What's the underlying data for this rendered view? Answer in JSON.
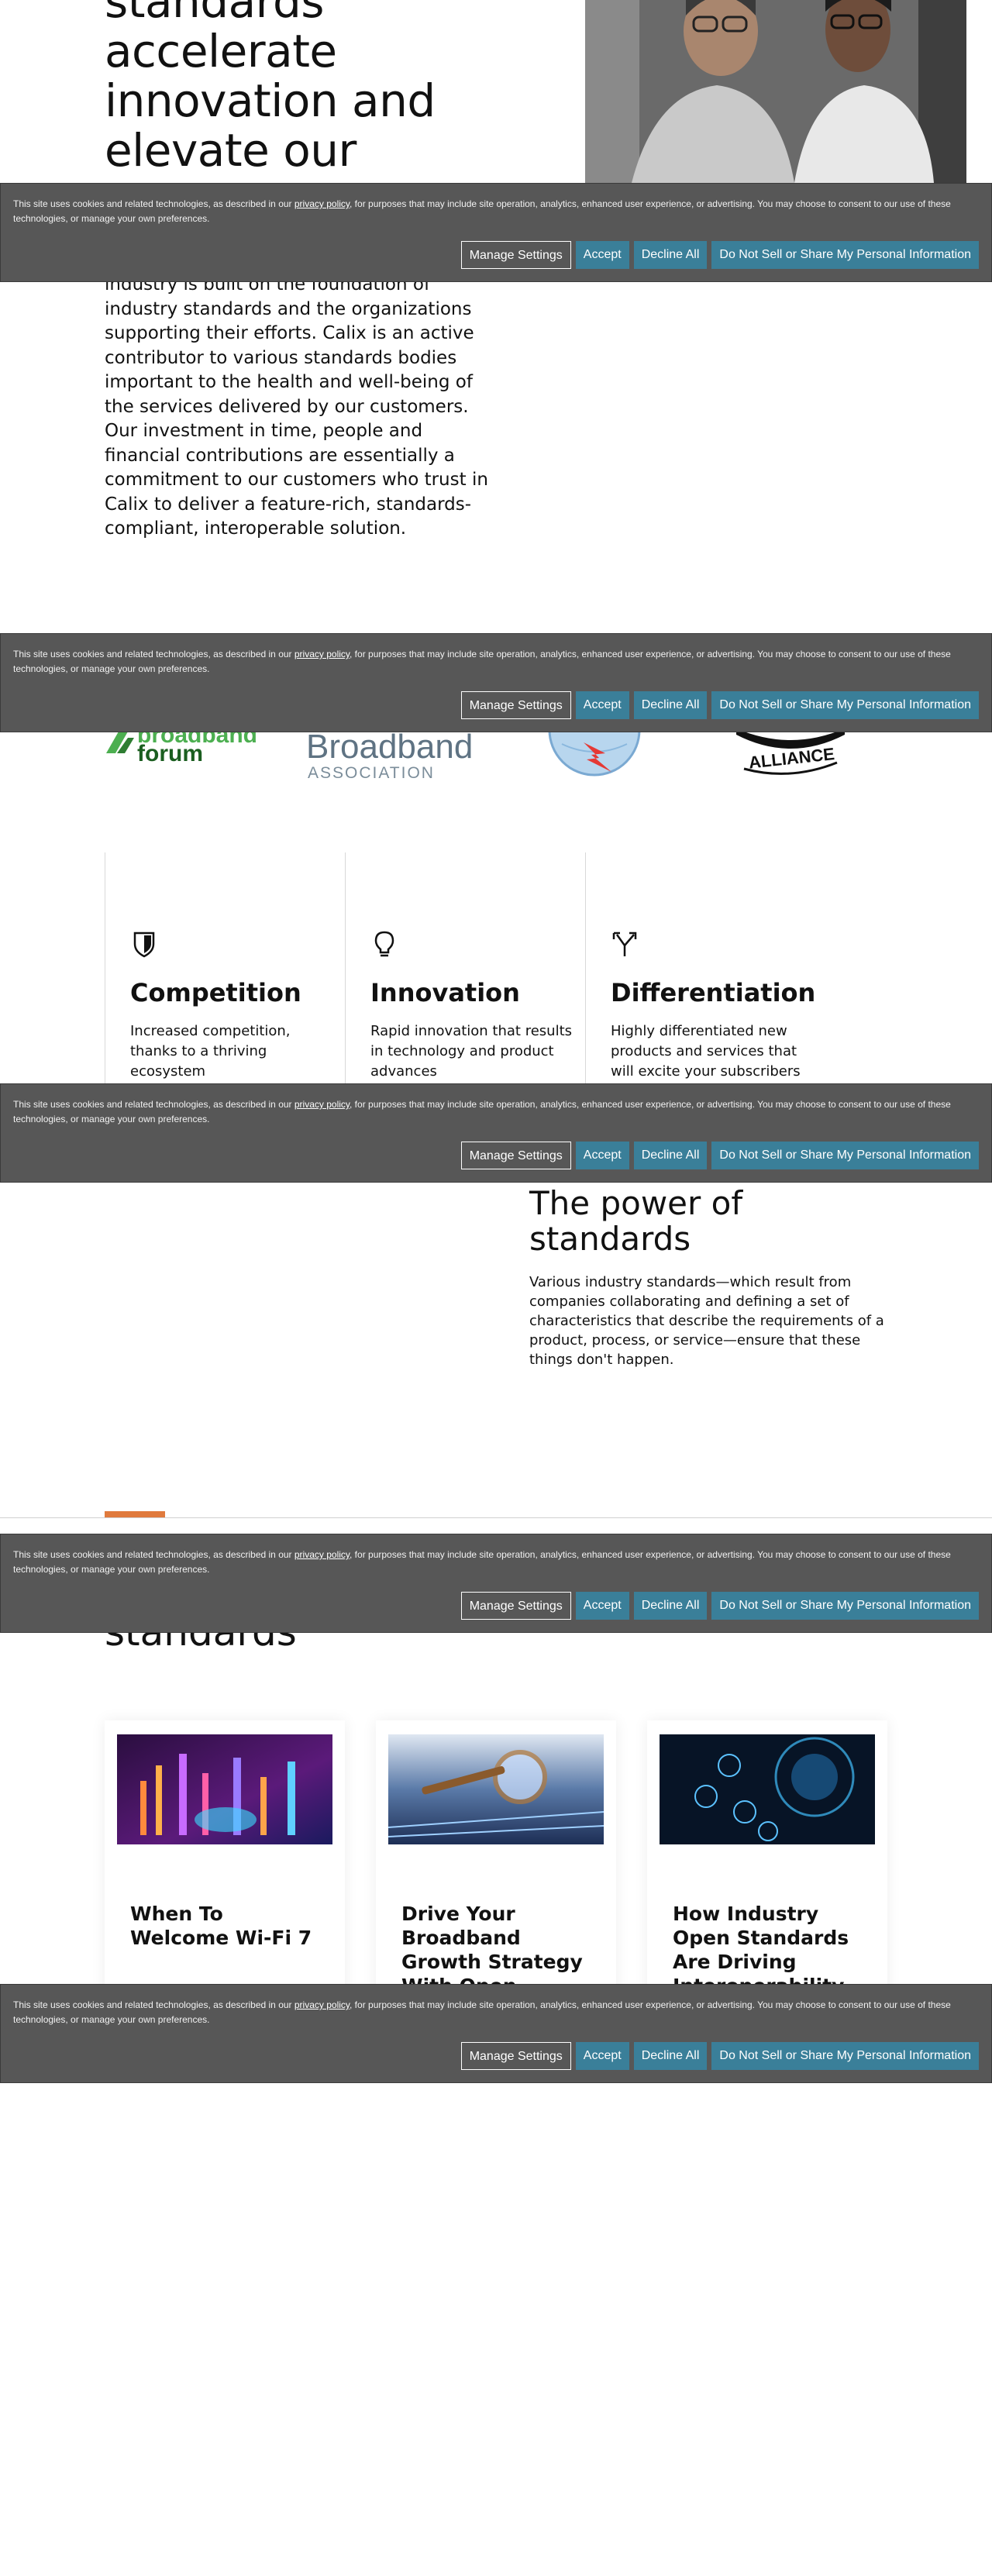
{
  "hero": {
    "title_lines": [
      "standards",
      "accelerate",
      "innovation and",
      "elevate our"
    ],
    "body": "industry is built on the foundation of industry standards and the organizations supporting their efforts. Calix is an active contributor to various standards bodies important to the health and well-being of the services delivered by our customers. Our investment in time, people and financial contributions are essentially a commitment to our customers who trust in Calix to deliver a feature-rich, standards-compliant, interoperable solution."
  },
  "logos": {
    "broadband_forum": [
      "broadband",
      "forum"
    ],
    "broadband_association": [
      "Broadband",
      "ASSOCIATION"
    ],
    "alliance": "ALLIANCE"
  },
  "pillars": [
    {
      "title": "Competition",
      "text": "Increased competition, thanks to a thriving ecosystem",
      "icon": "shield-icon"
    },
    {
      "title": "Innovation",
      "text": "Rapid innovation that results in technology and product advances",
      "icon": "lightbulb-icon"
    },
    {
      "title": "Differentiation",
      "text": "Highly differentiated new products and services that will excite your subscribers",
      "icon": "split-arrow-icon"
    }
  ],
  "power": {
    "title_lines": [
      "The power of",
      "standards"
    ],
    "body": "Various industry standards—which result from companies collaborating and defining a set of characteristics that describe the requirements of a product, process, or service—ensure that these things don't happen."
  },
  "articles": {
    "section_title": "standards",
    "cards": [
      {
        "title": "When To Welcome Wi-Fi 7"
      },
      {
        "title": "Drive Your Broadband Growth Strategy With Open Access Networks"
      },
      {
        "title": "How Industry Open Standards Are Driving Interoperability"
      }
    ]
  },
  "cookie": {
    "text_before": "This site uses cookies and related technologies, as described in our ",
    "link": "privacy policy",
    "text_after": ", for purposes that may include site operation, analytics, enhanced user experience, or advertising. You may choose to consent to our use of these technologies, or manage your own preferences.",
    "manage": "Manage Settings",
    "accept": "Accept",
    "decline": "Decline All",
    "dns": "Do Not Sell or Share My Personal Information"
  },
  "colors": {
    "accent": "#e07a3d",
    "cookie_bg": "#575757",
    "button": "#3a7f99"
  }
}
